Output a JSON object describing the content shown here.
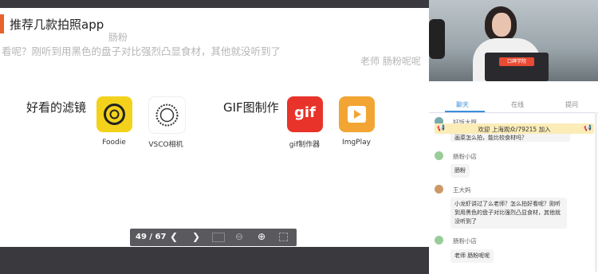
{
  "slide": {
    "title": "推荐几款拍照app",
    "danmaku": [
      {
        "text": "肠粉"
      },
      {
        "text": "看呢？刚听到用黑色的盘子对比强烈凸显食材，其他就没听到了"
      },
      {
        "text": "老师 肠粉呢呢"
      }
    ],
    "section_filter": "好看的滤镜",
    "section_gif": "GIF图制作",
    "apps": [
      {
        "name": "Foodie",
        "color": "#f4d21c"
      },
      {
        "name": "VSCO相机",
        "color": "#ffffff"
      },
      {
        "name": "gif制作器",
        "color": "#e8332a"
      },
      {
        "name": "ImgPlay",
        "color": "#f2a533"
      }
    ],
    "gif_icon_text": "gif"
  },
  "pager": {
    "page": "49 / 67"
  },
  "video": {
    "badge": "口碑学院"
  },
  "chat": {
    "tabs": [
      "聊天",
      "在线",
      "提问"
    ],
    "notice": "欢迎 上海观众/79215 加入",
    "messages": [
      {
        "user": "好饭大厨",
        "text": "画菜怎么拍，能比较食材吗？",
        "avatar": "#7aa"
      },
      {
        "user": "肠粉小店",
        "text": "肠粉",
        "avatar": "#9c9"
      },
      {
        "user": "王大妈",
        "text": "小龙虾讲过了么老师？怎么拍好看呢？刚听到用黑色的盘子对比强烈凸显食材，其他就没听到了",
        "avatar": "#c96"
      },
      {
        "user": "肠粉小店",
        "text": "老师 肠粉呢呢",
        "avatar": "#9c9"
      }
    ]
  }
}
